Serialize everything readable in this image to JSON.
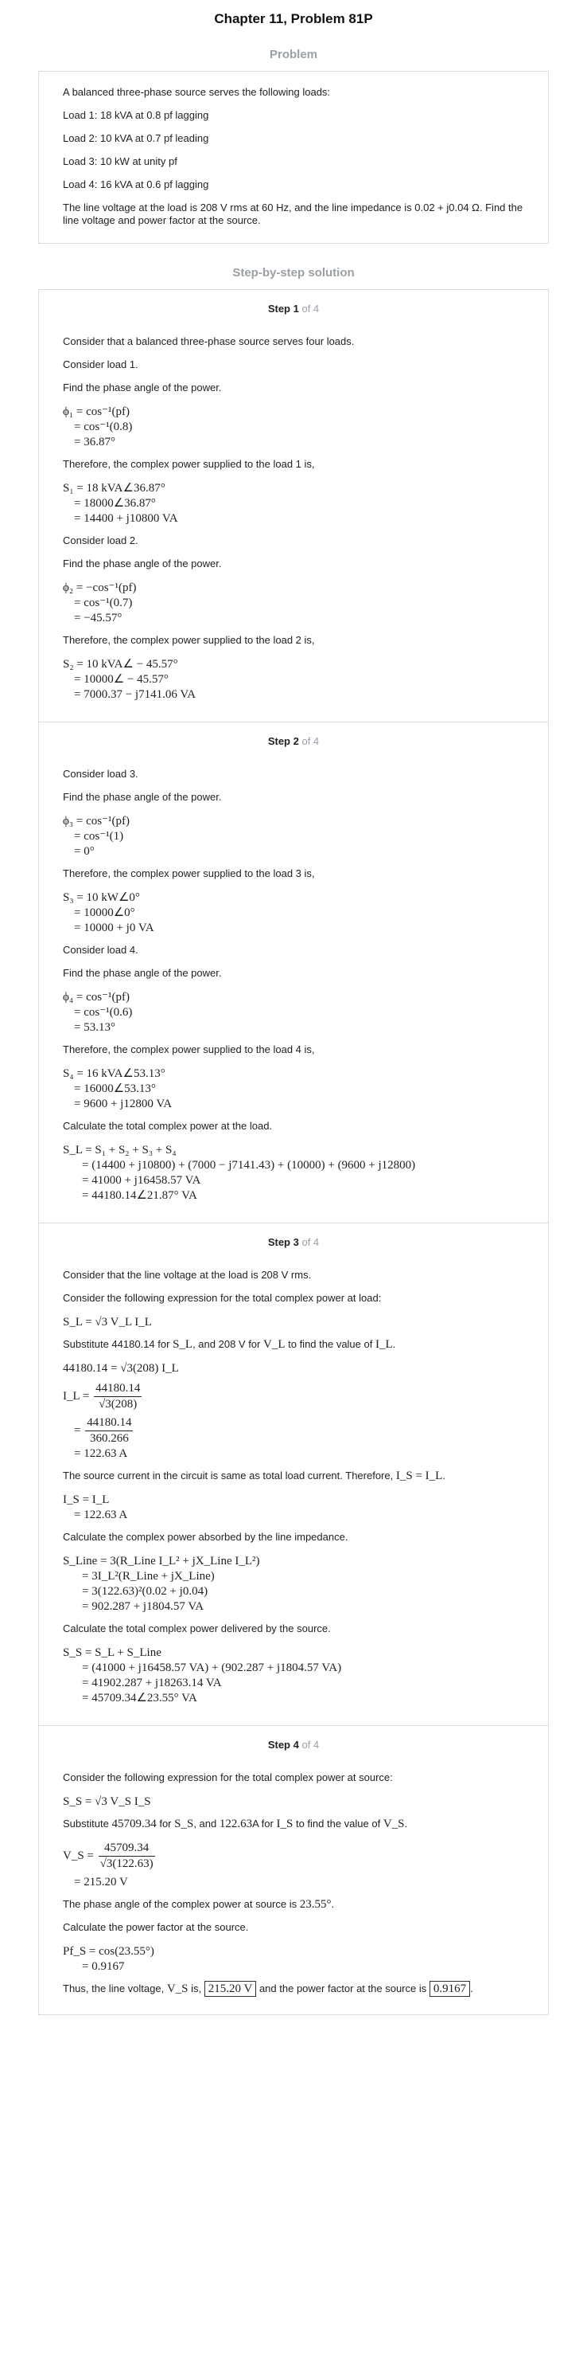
{
  "header": {
    "title": "Chapter 11, Problem 81P"
  },
  "problem": {
    "section_title": "Problem",
    "intro": "A balanced three-phase source serves the following loads:",
    "loads": [
      "Load 1: 18 kVA at 0.8 pf lagging",
      "Load 2: 10 kVA at 0.7 pf leading",
      "Load 3: 10 kW at unity pf",
      "Load 4: 16 kVA at 0.6 pf lagging"
    ],
    "statement": "The line voltage at the load is 208 V rms at 60 Hz, and the line impedance is 0.02 + j0.04 Ω. Find the line voltage and power factor at the source."
  },
  "solution": {
    "section_title": "Step-by-step solution",
    "of_label": "of 4",
    "step_labels": [
      "Step 1",
      "Step 2",
      "Step 3",
      "Step 4"
    ],
    "step1": {
      "t1": "Consider that a balanced three-phase source serves four loads.",
      "t2": "Consider load 1.",
      "t3": "Find the phase angle of the power.",
      "m1": [
        "ϕ₁ = cos⁻¹(pf)",
        "= cos⁻¹(0.8)",
        "= 36.87°"
      ],
      "t4": "Therefore, the complex power supplied to the load 1 is,",
      "m2": [
        "S₁ = 18 kVA∠36.87°",
        "= 18000∠36.87°",
        "= 14400 + j10800 VA"
      ],
      "t5": "Consider load 2.",
      "t6": "Find the phase angle of the power.",
      "m3": [
        "ϕ₂ = −cos⁻¹(pf)",
        "= cos⁻¹(0.7)",
        "= −45.57°"
      ],
      "t7": "Therefore, the complex power supplied to the load 2 is,",
      "m4": [
        "S₂ = 10 kVA∠ − 45.57°",
        "= 10000∠ − 45.57°",
        "= 7000.37 − j7141.06 VA"
      ]
    },
    "step2": {
      "t1": "Consider load 3.",
      "t2": "Find the phase angle of the power.",
      "m1": [
        "ϕ₃ = cos⁻¹(pf)",
        "= cos⁻¹(1)",
        "= 0°"
      ],
      "t3": "Therefore, the complex power supplied to the load 3 is,",
      "m2": [
        "S₃ = 10 kW∠0°",
        "= 10000∠0°",
        "= 10000 + j0 VA"
      ],
      "t4": "Consider load 4.",
      "t5": "Find the phase angle of the power.",
      "m3": [
        "ϕ₄ = cos⁻¹(pf)",
        "= cos⁻¹(0.6)",
        "= 53.13°"
      ],
      "t6": "Therefore, the complex power supplied to the load 4 is,",
      "m4": [
        "S₄ = 16 kVA∠53.13°",
        "= 16000∠53.13°",
        "= 9600 + j12800 VA"
      ],
      "t7": "Calculate the total complex power at the load.",
      "m5": [
        "S_L = S₁ + S₂ + S₃ + S₄",
        "= (14400 + j10800) + (7000 − j7141.43) + (10000) + (9600 + j12800)",
        "= 41000 + j16458.57 VA",
        "= 44180.14∠21.87° VA"
      ]
    },
    "step3": {
      "t1": "Consider that the line voltage at the load is 208 V rms.",
      "t2": "Consider the following expression for the total complex power at load:",
      "m1": "S_L = √3 V_L I_L",
      "t3a": "Substitute 44180.14 for",
      "t3b": "S_L",
      "t3c": ", and 208 V for",
      "t3d": "V_L",
      "t3e": "to find the value of",
      "t3f": "I_L",
      "m2a": "44180.14 = √3(208) I_L",
      "m2b_pre": "I_L =",
      "m2b_num": "44180.14",
      "m2b_den": "√3(208)",
      "m2c_pre": "=",
      "m2c_num": "44180.14",
      "m2c_den": "360.266",
      "m2d": "= 122.63 A",
      "t4a": "The source current in the circuit is same as total load current. Therefore,",
      "t4b": "I_S = I_L",
      "m3": [
        "I_S = I_L",
        "= 122.63 A"
      ],
      "t5": "Calculate the complex power absorbed by the line impedance.",
      "m4": [
        "S_Line = 3(R_Line I_L² + jX_Line I_L²)",
        "= 3I_L²(R_Line + jX_Line)",
        "= 3(122.63)²(0.02 + j0.04)",
        "= 902.287 + j1804.57 VA"
      ],
      "t6": "Calculate the total complex power delivered by the source.",
      "m5": [
        "S_S = S_L + S_Line",
        "= (41000 + j16458.57 VA) + (902.287 + j1804.57 VA)",
        "= 41902.287 + j18263.14 VA",
        "= 45709.34∠23.55° VA"
      ]
    },
    "step4": {
      "t1": "Consider the following expression for the total complex power at source:",
      "m1": "S_S = √3 V_S I_S",
      "t2a": "Substitute",
      "t2b": "45709.34",
      "t2c": "for",
      "t2d": "S_S",
      "t2e": ", and",
      "t2f": "122.63",
      "t2g": "A for",
      "t2h": "I_S",
      "t2i": "to find the value of",
      "t2j": "V_S",
      "m2_pre": "V_S =",
      "m2_num": "45709.34",
      "m2_den": "√3(122.63)",
      "m2b": "= 215.20 V",
      "t3a": "The phase angle of the complex power at source is",
      "t3b": "23.55°",
      "t4": "Calculate the power factor at the source.",
      "m3": [
        "Pf_S = cos(23.55°)",
        "= 0.9167"
      ],
      "t5a": "Thus, the line voltage,",
      "t5b": "V_S",
      "t5c": "is,",
      "t5d": "215.20 V",
      "t5e": "and the power factor at the source is",
      "t5f": "0.9167"
    }
  }
}
